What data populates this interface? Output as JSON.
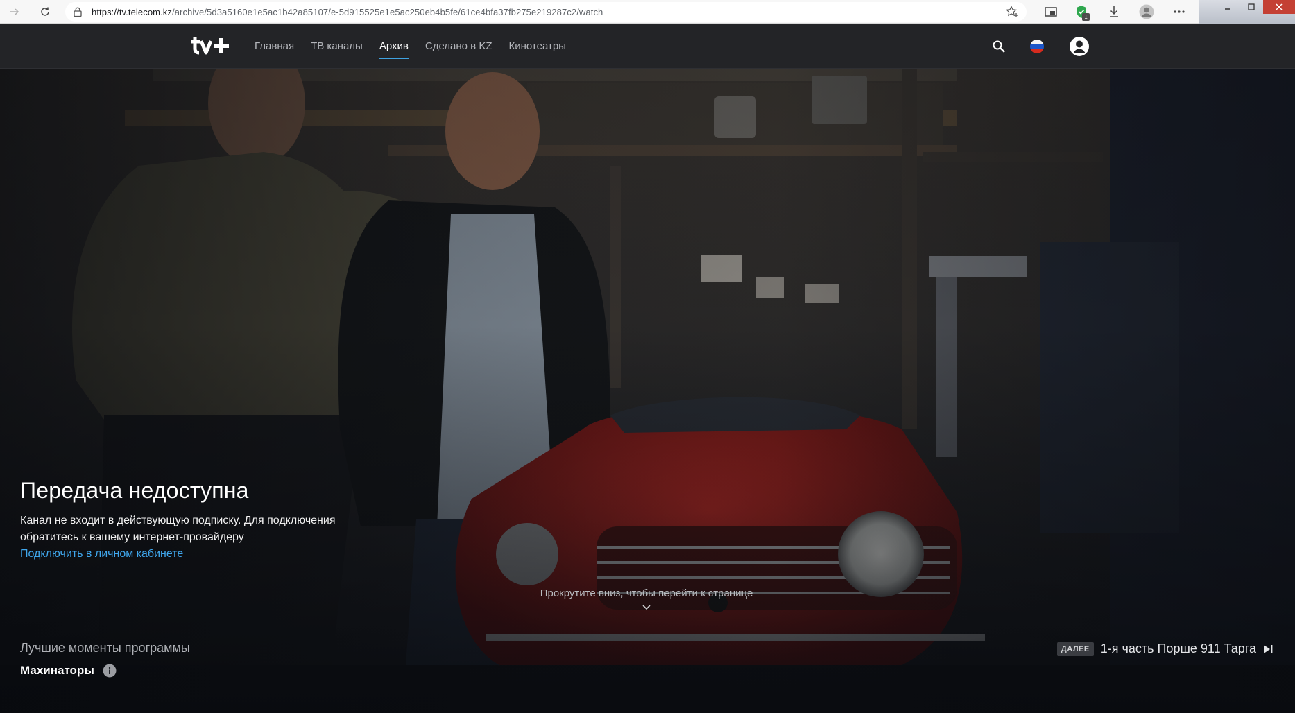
{
  "browser": {
    "url_host": "https://tv.telecom.kz",
    "url_path": "/archive/5d3a5160e1e5ac1b42a85107/e-5d915525e1e5ac250eb4b5fe/61ce4bfa37fb275e219287c2/watch",
    "extension_badge": "1"
  },
  "header": {
    "logo_text": "tv+",
    "nav": [
      {
        "label": "Главная",
        "active": false
      },
      {
        "label": "ТВ каналы",
        "active": false
      },
      {
        "label": "Архив",
        "active": true
      },
      {
        "label": "Сделано в KZ",
        "active": false
      },
      {
        "label": "Кинотеатры",
        "active": false
      }
    ],
    "icons": [
      "search-icon",
      "russian-flag-icon",
      "account-icon"
    ]
  },
  "hero": {
    "title": "Передача недоступна",
    "message": "Канал не входит в действующую подписку. Для подключения обратитесь к вашему интернет-провайдеру",
    "link": "Подключить в личном кабинете",
    "scroll_hint": "Прокрутите вниз, чтобы перейти к странице",
    "program_subtitle": "Лучшие моменты программы",
    "program_title": "Махинаторы",
    "next_badge": "ДАЛЕЕ",
    "next_title": "1-я часть Порше 911 Тарга"
  },
  "colors": {
    "accent": "#3fa2e0",
    "link": "#3fa6ec",
    "header_bg": "#232427",
    "car_red": "#a3231f"
  }
}
